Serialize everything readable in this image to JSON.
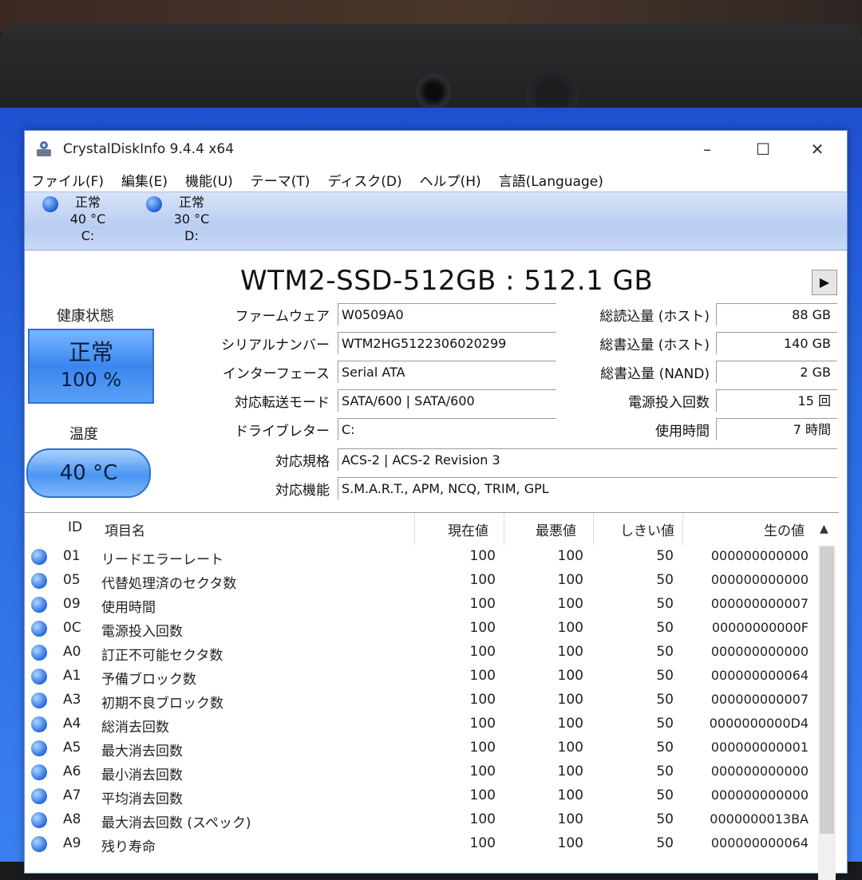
{
  "window": {
    "title": "CrystalDiskInfo 9.4.4 x64"
  },
  "menu": [
    "ファイル(F)",
    "編集(E)",
    "機能(U)",
    "テーマ(T)",
    "ディスク(D)",
    "ヘルプ(H)",
    "言語(Language)"
  ],
  "drives": [
    {
      "status": "正常",
      "temp": "40 °C",
      "letter": "C:"
    },
    {
      "status": "正常",
      "temp": "30 °C",
      "letter": "D:"
    }
  ],
  "disk": {
    "model": "WTM2-SSD-512GB : 512.1 GB",
    "health_label": "健康状態",
    "health_status": "正常",
    "health_percent": "100 %",
    "temp_label": "温度",
    "temperature": "40 °C",
    "left_fields": [
      {
        "label": "ファームウェア",
        "value": "W0509A0"
      },
      {
        "label": "シリアルナンバー",
        "value": "WTM2HG5122306020299"
      },
      {
        "label": "インターフェース",
        "value": "Serial ATA"
      },
      {
        "label": "対応転送モード",
        "value": "SATA/600 | SATA/600"
      },
      {
        "label": "ドライブレター",
        "value": "C:"
      }
    ],
    "right_fields": [
      {
        "label": "総読込量 (ホスト)",
        "value": "88 GB"
      },
      {
        "label": "総書込量 (ホスト)",
        "value": "140 GB"
      },
      {
        "label": "総書込量 (NAND)",
        "value": "2 GB"
      },
      {
        "label": "電源投入回数",
        "value": "15 回"
      },
      {
        "label": "使用時間",
        "value": "7 時間"
      }
    ],
    "wide_fields": [
      {
        "label": "対応規格",
        "value": "ACS-2 | ACS-2 Revision 3"
      },
      {
        "label": "対応機能",
        "value": "S.M.A.R.T., APM, NCQ, TRIM, GPL"
      }
    ]
  },
  "smart": {
    "headers": {
      "id": "ID",
      "name": "項目名",
      "current": "現在値",
      "worst": "最悪値",
      "threshold": "しきい値",
      "raw": "生の値"
    },
    "rows": [
      {
        "id": "01",
        "name": "リードエラーレート",
        "current": "100",
        "worst": "100",
        "threshold": "50",
        "raw": "000000000000"
      },
      {
        "id": "05",
        "name": "代替処理済のセクタ数",
        "current": "100",
        "worst": "100",
        "threshold": "50",
        "raw": "000000000000"
      },
      {
        "id": "09",
        "name": "使用時間",
        "current": "100",
        "worst": "100",
        "threshold": "50",
        "raw": "000000000007"
      },
      {
        "id": "0C",
        "name": "電源投入回数",
        "current": "100",
        "worst": "100",
        "threshold": "50",
        "raw": "00000000000F"
      },
      {
        "id": "A0",
        "name": "訂正不可能セクタ数",
        "current": "100",
        "worst": "100",
        "threshold": "50",
        "raw": "000000000000"
      },
      {
        "id": "A1",
        "name": "予備ブロック数",
        "current": "100",
        "worst": "100",
        "threshold": "50",
        "raw": "000000000064"
      },
      {
        "id": "A3",
        "name": "初期不良ブロック数",
        "current": "100",
        "worst": "100",
        "threshold": "50",
        "raw": "000000000007"
      },
      {
        "id": "A4",
        "name": "総消去回数",
        "current": "100",
        "worst": "100",
        "threshold": "50",
        "raw": "0000000000D4"
      },
      {
        "id": "A5",
        "name": "最大消去回数",
        "current": "100",
        "worst": "100",
        "threshold": "50",
        "raw": "000000000001"
      },
      {
        "id": "A6",
        "name": "最小消去回数",
        "current": "100",
        "worst": "100",
        "threshold": "50",
        "raw": "000000000000"
      },
      {
        "id": "A7",
        "name": "平均消去回数",
        "current": "100",
        "worst": "100",
        "threshold": "50",
        "raw": "000000000000"
      },
      {
        "id": "A8",
        "name": "最大消去回数 (スペック)",
        "current": "100",
        "worst": "100",
        "threshold": "50",
        "raw": "0000000013BA"
      },
      {
        "id": "A9",
        "name": "残り寿命",
        "current": "100",
        "worst": "100",
        "threshold": "50",
        "raw": "000000000064"
      }
    ]
  }
}
